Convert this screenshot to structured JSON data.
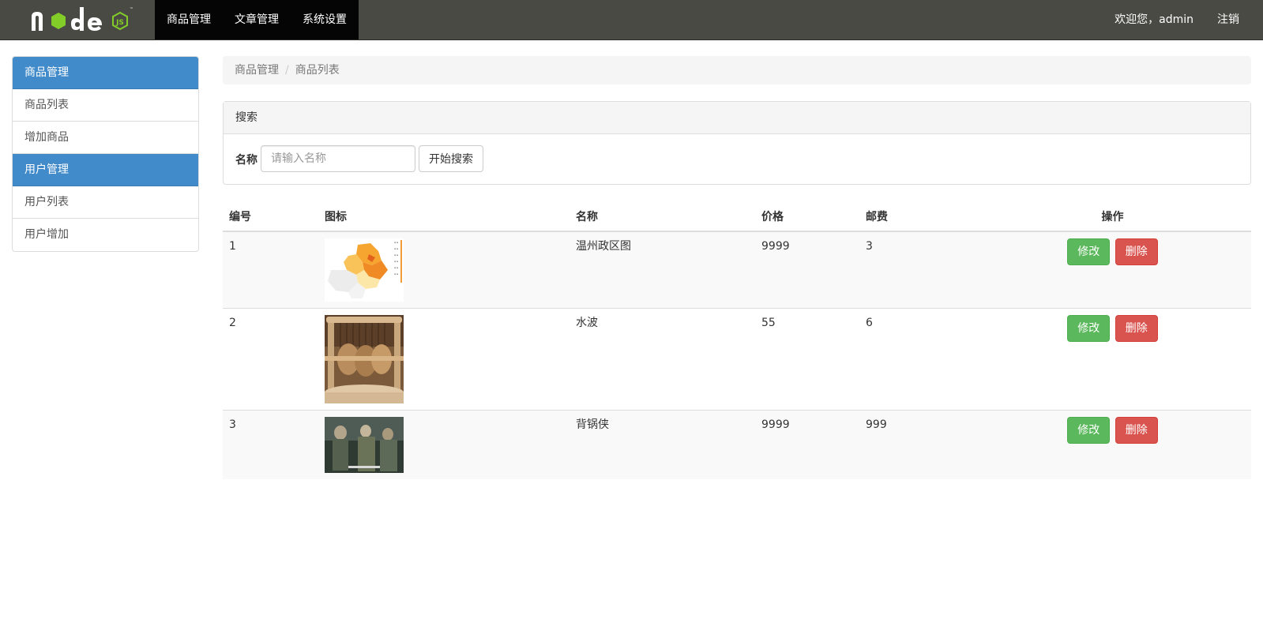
{
  "navbar": {
    "logo_text": "node",
    "logo_badge": "JS",
    "menu": [
      {
        "label": "商品管理"
      },
      {
        "label": "文章管理"
      },
      {
        "label": "系统设置"
      }
    ],
    "welcome": "欢迎您，admin",
    "logout": "注销"
  },
  "sidebar": {
    "groups": [
      {
        "title": "商品管理",
        "items": [
          {
            "label": "商品列表"
          },
          {
            "label": "增加商品"
          }
        ]
      },
      {
        "title": "用户管理",
        "items": [
          {
            "label": "用户列表"
          },
          {
            "label": "用户增加"
          }
        ]
      }
    ]
  },
  "breadcrumb": {
    "items": [
      {
        "label": "商品管理"
      },
      {
        "label": "商品列表"
      }
    ],
    "separator": "/"
  },
  "search": {
    "panel_title": "搜索",
    "label": "名称",
    "placeholder": "请输入名称",
    "value": "",
    "button": "开始搜索"
  },
  "table": {
    "headers": {
      "id": "编号",
      "icon": "图标",
      "name": "名称",
      "price": "价格",
      "shipping": "邮费",
      "actions": "操作"
    },
    "rows": [
      {
        "id": "1",
        "image": "wenzhou-district-map",
        "name": "温州政区图",
        "price": "9999",
        "shipping": "3",
        "edit": "修改",
        "delete": "删除"
      },
      {
        "id": "2",
        "image": "wooden-wave-sculpture",
        "name": "水波",
        "price": "55",
        "shipping": "6",
        "edit": "修改",
        "delete": "删除"
      },
      {
        "id": "3",
        "image": "movie-still",
        "name": "背锅侠",
        "price": "9999",
        "shipping": "999",
        "edit": "修改",
        "delete": "删除"
      }
    ]
  },
  "colors": {
    "navbar": "#4a4a44",
    "nav_active": "#050505",
    "sidebar_header": "#428bca",
    "edit_button": "#5cb85c",
    "delete_button": "#d9534f",
    "node_green": "#83cd29"
  }
}
